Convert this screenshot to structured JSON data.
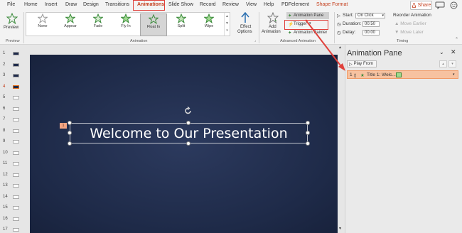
{
  "menu": {
    "items": [
      "File",
      "Home",
      "Insert",
      "Draw",
      "Design",
      "Transitions",
      "Animations",
      "Slide Show",
      "Record",
      "Review",
      "View",
      "Help",
      "PDFelement",
      "Shape Format"
    ],
    "share": "Share"
  },
  "ribbon": {
    "preview": {
      "label": "Preview",
      "group": "Preview"
    },
    "animations": [
      "None",
      "Appear",
      "Fade",
      "Fly In",
      "Float In",
      "Split",
      "Wipe"
    ],
    "animations_group": "Animation",
    "effect_options": [
      "Effect",
      "Options"
    ],
    "add_animation": [
      "Add",
      "Animation"
    ],
    "animation_pane": "Animation Pane",
    "trigger": "Trigger",
    "animation_painter": "Animation Painter",
    "advanced_group": "Advanced Animation",
    "start_label": "Start:",
    "start_value": "On Click",
    "duration_label": "Duration:",
    "duration_value": "00.50",
    "delay_label": "Delay:",
    "delay_value": "00.00",
    "reorder": "Reorder Animation",
    "move_earlier": "Move Earlier",
    "move_later": "Move Later",
    "timing_group": "Timing"
  },
  "thumbnails": [
    "1",
    "2",
    "3",
    "4",
    "5",
    "6",
    "7",
    "8",
    "9",
    "10",
    "11",
    "12",
    "13",
    "14",
    "15",
    "16",
    "17"
  ],
  "slide": {
    "title": "Welcome to Our Presentation",
    "anim_tag": "1"
  },
  "pane": {
    "title": "Animation Pane",
    "play_from": "Play From",
    "item_number": "1",
    "item_label": "Title 1: Welc..."
  },
  "colors": {
    "accent": "#c43e1c",
    "highlight": "#e0413c",
    "slide_bg": "#1f2b4b",
    "pane_item": "#f7c2a0"
  }
}
